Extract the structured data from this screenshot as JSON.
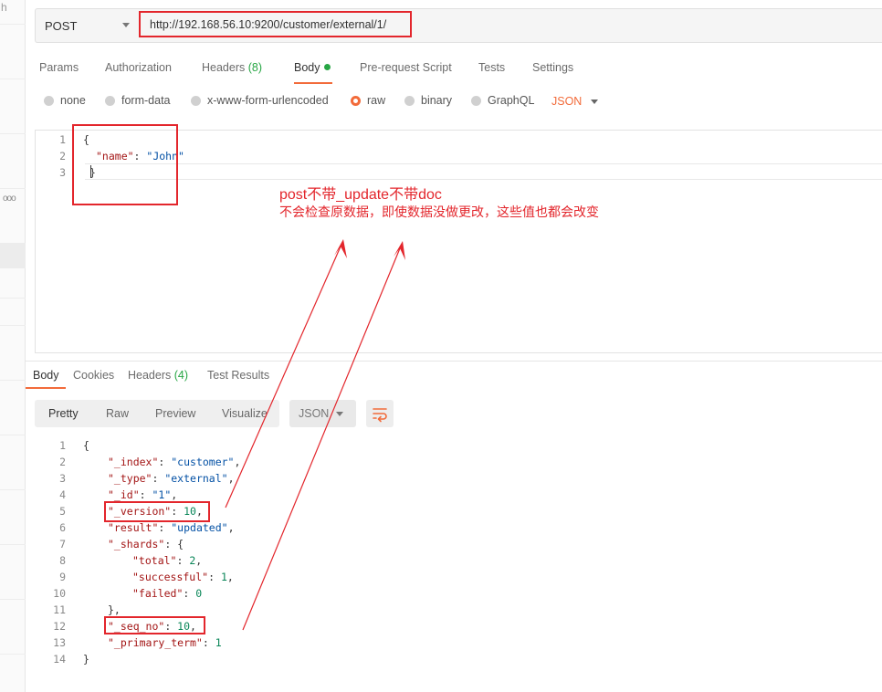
{
  "sidebar": {
    "fragment": "h",
    "more": "ooo"
  },
  "request": {
    "method": "POST",
    "url": "http://192.168.56.10:9200/customer/external/1/",
    "tabs": [
      {
        "label": "Params"
      },
      {
        "label": "Authorization"
      },
      {
        "label": "Headers",
        "count": "(8)"
      },
      {
        "label": "Body"
      },
      {
        "label": "Pre-request Script"
      },
      {
        "label": "Tests"
      },
      {
        "label": "Settings"
      }
    ],
    "body_types": [
      "none",
      "form-data",
      "x-www-form-urlencoded",
      "raw",
      "binary",
      "GraphQL"
    ],
    "selected_body_type": "raw",
    "format": "JSON",
    "code": {
      "line_numbers": [
        "1",
        "2",
        "3"
      ],
      "open": "{",
      "key": "\"name\"",
      "colon": ": ",
      "value": "\"John\"",
      "close": "}"
    }
  },
  "annotations": {
    "title": "post不带_update不带doc",
    "note": "不会检查原数据，即使数据没做更改，这些值也都会改变"
  },
  "response": {
    "tabs": [
      {
        "label": "Body"
      },
      {
        "label": "Cookies"
      },
      {
        "label": "Headers",
        "count": "(4)"
      },
      {
        "label": "Test Results"
      }
    ],
    "view_modes": [
      "Pretty",
      "Raw",
      "Preview",
      "Visualize"
    ],
    "format": "JSON",
    "line_numbers": [
      "1",
      "2",
      "3",
      "4",
      "5",
      "6",
      "7",
      "8",
      "9",
      "10",
      "11",
      "12",
      "13",
      "14"
    ],
    "json": {
      "open": "{",
      "index_key": "\"_index\"",
      "index_val": "\"customer\"",
      "type_key": "\"_type\"",
      "type_val": "\"external\"",
      "id_key": "\"_id\"",
      "id_val": "\"1\"",
      "version_key": "\"_version\"",
      "version_val": "10",
      "result_key": "\"result\"",
      "result_val": "\"updated\"",
      "shards_key": "\"_shards\"",
      "shards_open": "{",
      "total_key": "\"total\"",
      "total_val": "2",
      "successful_key": "\"successful\"",
      "successful_val": "1",
      "failed_key": "\"failed\"",
      "failed_val": "0",
      "shards_close": "},",
      "seq_key": "\"_seq_no\"",
      "seq_val": "10",
      "term_key": "\"_primary_term\"",
      "term_val": "1",
      "close": "}"
    }
  },
  "colors": {
    "accent": "#f26b3a",
    "annotation": "#e3262c",
    "count": "#27a644"
  }
}
